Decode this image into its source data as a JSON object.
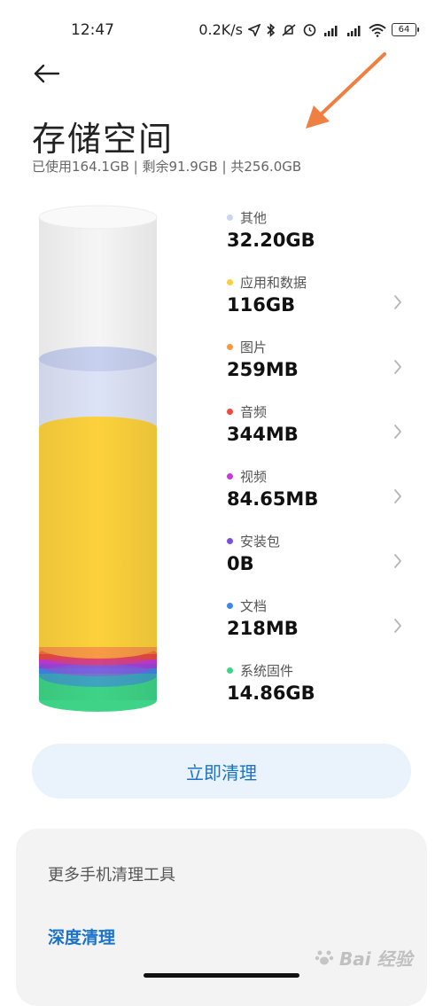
{
  "status_bar": {
    "time": "12:47",
    "net_speed": "0.2K/s",
    "battery": "64",
    "icons": [
      "location-icon",
      "bluetooth-icon",
      "mute-icon",
      "alarm-icon",
      "signal-hd-1-icon",
      "signal-hd-2-icon",
      "wifi-icon",
      "battery-icon"
    ]
  },
  "header": {
    "back_icon": "back-arrow-icon",
    "title": "存储空间",
    "summary": "已使用164.1GB | 剩余91.9GB | 共256.0GB"
  },
  "storage": {
    "items": [
      {
        "name": "其他",
        "size": "32.20GB",
        "color": "#ccd5ee",
        "has_chevron": false
      },
      {
        "name": "应用和数据",
        "size": "116GB",
        "color": "#fbd03a",
        "has_chevron": true
      },
      {
        "name": "图片",
        "size": "259MB",
        "color": "#f59a43",
        "has_chevron": true
      },
      {
        "name": "音频",
        "size": "344MB",
        "color": "#ec4a3c",
        "has_chevron": true
      },
      {
        "name": "视频",
        "size": "84.65MB",
        "color": "#c63ad6",
        "has_chevron": true
      },
      {
        "name": "安装包",
        "size": "0B",
        "color": "#7a4fd9",
        "has_chevron": true
      },
      {
        "name": "文档",
        "size": "218MB",
        "color": "#3f86e6",
        "has_chevron": true
      },
      {
        "name": "系统固件",
        "size": "14.86GB",
        "color": "#3ed386",
        "has_chevron": false
      }
    ]
  },
  "actions": {
    "clean_label": "立即清理"
  },
  "tools": {
    "title": "更多手机清理工具",
    "deep_clean": "深度清理"
  },
  "watermark": "Bai 经验",
  "colors": {
    "accent": "#1a73c8",
    "button_bg": "#eaf3fc",
    "arrow": "#f07f42"
  }
}
